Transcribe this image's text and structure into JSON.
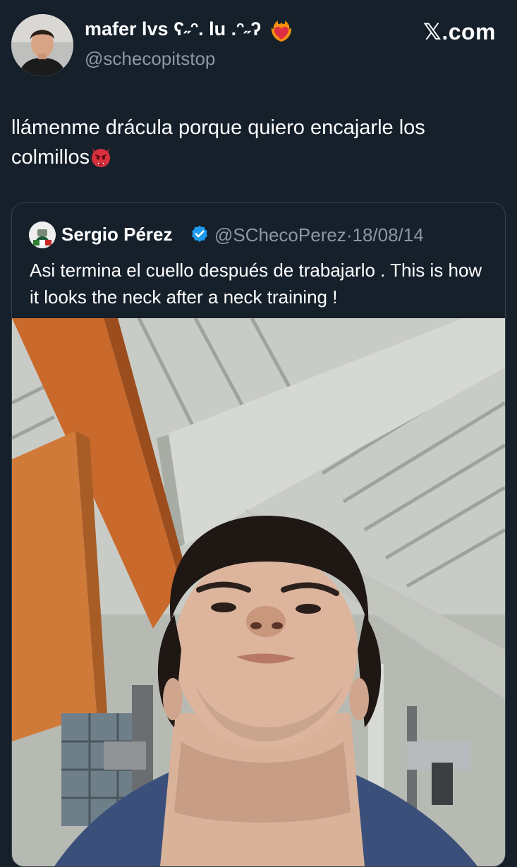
{
  "post": {
    "display_name": "mafer lvs ʕ˶ᵔ. lu .ᵔ˶ʔ",
    "handle": "@schecopitstop",
    "watermark": "𝕏.com",
    "text": "llámenme drácula porque quiero encajarle los colmillos"
  },
  "quote": {
    "author_name": "Sergio Pérez",
    "author_handle": "@SChecoPerez",
    "separator": "·",
    "date": "18/08/14",
    "text": "Asi termina el cuello después de trabajarlo . This is how it looks the neck after a neck training !",
    "photo_alt": "Selfie looking up under a gym ceiling"
  },
  "icons": {
    "heart": "heart-on-fire-icon",
    "devil": "angry-devil-icon",
    "verified": "verified-badge-icon"
  },
  "colors": {
    "background": "#15202b",
    "secondary_text": "#8b98a5",
    "border": "#38444d",
    "verified": "#1d9bf0"
  }
}
